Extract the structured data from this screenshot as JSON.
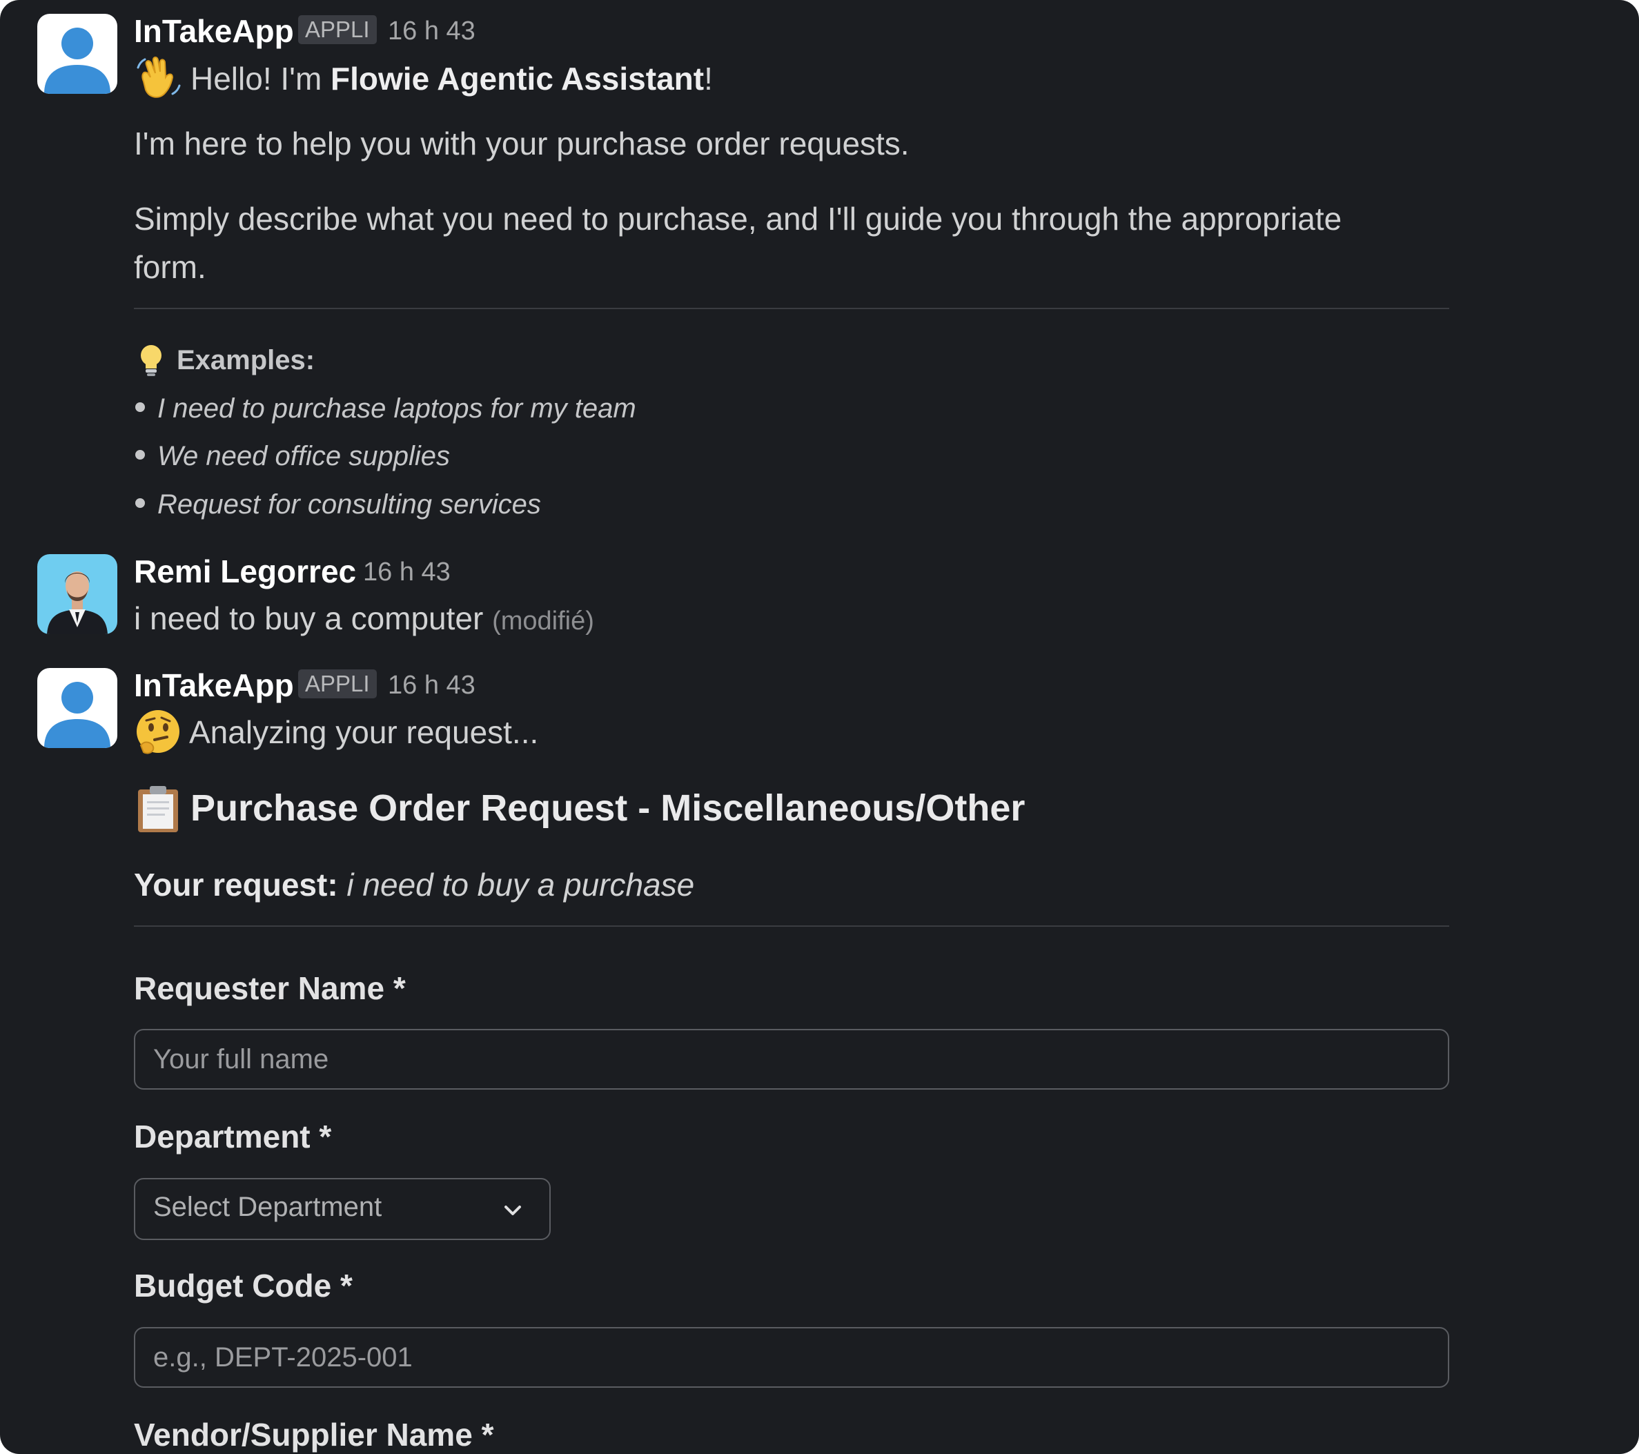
{
  "messages": [
    {
      "author": "InTakeApp",
      "badge": "APPLI",
      "time": "16 h 43",
      "avatar_icon": "default-user-avatar-icon",
      "greeting_prefix": "Hello! I'm ",
      "greeting_bold": "Flowie Agentic Assistant",
      "greeting_suffix": "!",
      "greeting_icon": "waving-hand-icon",
      "line1": "I'm here to help you with your purchase order requests.",
      "line2": "Simply describe what you need to purchase, and I'll guide you through the appropriate form.",
      "examples_icon": "lightbulb-icon",
      "examples_title": "Examples:",
      "examples": [
        "I need to purchase laptops for my team",
        "We need office supplies",
        "Request for consulting services"
      ]
    },
    {
      "author": "Remi Legorrec",
      "time": "16 h 43",
      "avatar_icon": "user-photo-avatar",
      "text": "i need to buy a computer",
      "edited": "(modifié)"
    },
    {
      "author": "InTakeApp",
      "badge": "APPLI",
      "time": "16 h 43",
      "avatar_icon": "default-user-avatar-icon",
      "status_icon": "thinking-face-icon",
      "status": "Analyzing your request...",
      "heading_icon": "clipboard-icon",
      "heading": "Purchase Order Request - Miscellaneous/Other",
      "request_label": "Your request:",
      "request_value": "i need to buy a purchase"
    }
  ],
  "form": {
    "requester_label": "Requester Name *",
    "requester_placeholder": "Your full name",
    "department_label": "Department *",
    "department_selected": "Select Department",
    "budget_label": "Budget Code *",
    "budget_placeholder": "e.g., DEPT-2025-001",
    "vendor_label": "Vendor/Supplier Name *"
  },
  "colors": {
    "background": "#1b1d21",
    "text": "#d1d2d3",
    "avatar_blue": "#3a8fd8"
  }
}
